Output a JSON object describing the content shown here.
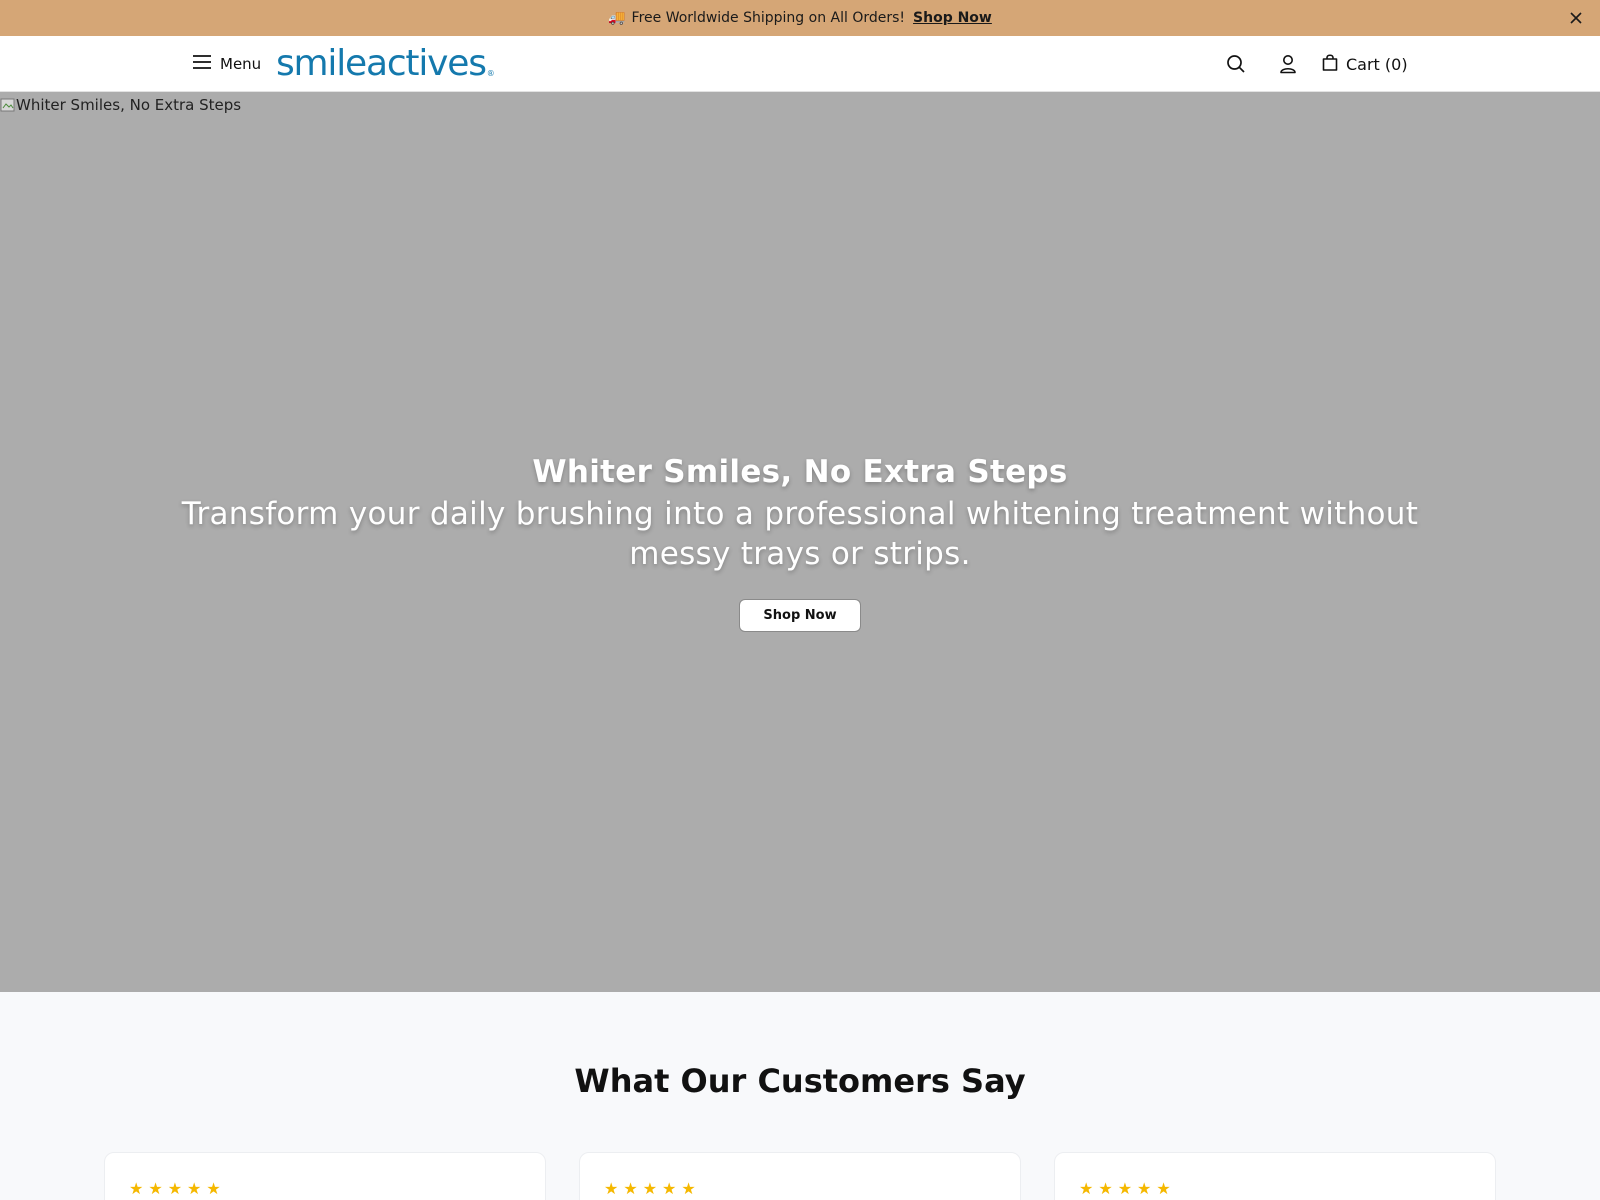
{
  "announcement": {
    "truck_icon": "🚚",
    "text": "Free Worldwide Shipping on All Orders!",
    "link_label": "Shop Now",
    "close_icon": "close-icon"
  },
  "header": {
    "menu_label": "Menu",
    "logo_text": "smileactives",
    "logo_reg": "®",
    "cart_label": "Cart (0)",
    "brand_color": "#1479ad"
  },
  "hero": {
    "image_alt": "Whiter Smiles, No Extra Steps",
    "title": "Whiter Smiles, No Extra Steps",
    "subtitle": "Transform your daily brushing into a professional whitening treatment without messy trays or strips.",
    "button_label": "Shop Now"
  },
  "reviews": {
    "title": "What Our Customers Say",
    "cards": [
      {
        "stars": "★★★★★"
      },
      {
        "stars": "★★★★★"
      },
      {
        "stars": "★★★★★"
      }
    ]
  }
}
